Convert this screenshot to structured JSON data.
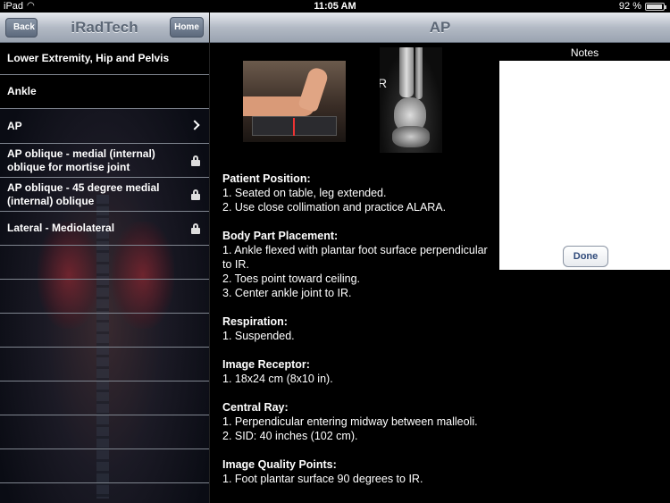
{
  "status_bar": {
    "carrier": "iPad",
    "time": "11:05 AM",
    "battery": "92 %",
    "battery_level": 0.92
  },
  "left_nav": {
    "title": "iRadTech",
    "back_label": "Back",
    "home_label": "Home"
  },
  "right_nav": {
    "title": "AP"
  },
  "list": {
    "items": [
      {
        "label": "Lower Extremity, Hip and Pelvis",
        "accessory": "none"
      },
      {
        "label": "Ankle",
        "accessory": "none"
      },
      {
        "label": "AP",
        "accessory": "chevron"
      },
      {
        "label": "AP oblique - medial (internal) oblique for mortise joint",
        "accessory": "lock"
      },
      {
        "label": "AP oblique - 45 degree medial (internal) oblique",
        "accessory": "lock"
      },
      {
        "label": "Lateral - Mediolateral",
        "accessory": "lock"
      }
    ]
  },
  "images": {
    "xray_marker": "R"
  },
  "content": {
    "sections": [
      {
        "heading": "Patient Position:",
        "lines": [
          "1. Seated on table, leg extended.",
          "2. Use close collimation and practice ALARA."
        ]
      },
      {
        "heading": "Body Part Placement:",
        "lines": [
          "1. Ankle flexed with plantar foot  surface perpendicular to IR.",
          "2. Toes point toward ceiling.",
          "3. Center ankle joint to IR."
        ]
      },
      {
        "heading": "Respiration:",
        "lines": [
          "1. Suspended."
        ]
      },
      {
        "heading": "Image Receptor:",
        "lines": [
          "1. 18x24 cm (8x10 in)."
        ]
      },
      {
        "heading": "Central Ray:",
        "lines": [
          "1. Perpendicular entering midway between malleoli.",
          "2. SID: 40 inches (102 cm)."
        ]
      },
      {
        "heading": "Image Quality Points:",
        "lines": [
          "1. Foot plantar surface 90 degrees to IR."
        ]
      }
    ]
  },
  "notes": {
    "title": "Notes",
    "done_label": "Done"
  }
}
